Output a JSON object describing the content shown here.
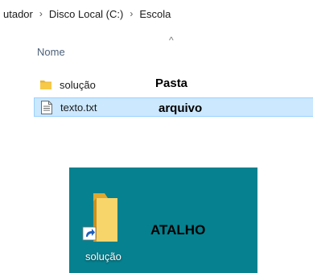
{
  "breadcrumb": {
    "items": [
      "utador",
      "Disco Local (C:)",
      "Escola"
    ],
    "separator": "›"
  },
  "list": {
    "sort_arrow": "^",
    "column_header": "Nome",
    "rows": [
      {
        "name": "solução",
        "type_icon": "folder-icon",
        "annotation": "Pasta",
        "selected": false
      },
      {
        "name": "texto.txt",
        "type_icon": "text-file-icon",
        "annotation": "arquivo",
        "selected": true
      }
    ]
  },
  "desktop": {
    "background_color": "#06818f",
    "shortcut": {
      "label": "solução",
      "icon": "folder-shortcut-icon",
      "annotation": "ATALHO"
    }
  },
  "colors": {
    "selection_bg": "#cce8ff",
    "selection_border": "#99d1ff",
    "folder_yellow": "#f7c948",
    "header_text": "#4c607a"
  }
}
